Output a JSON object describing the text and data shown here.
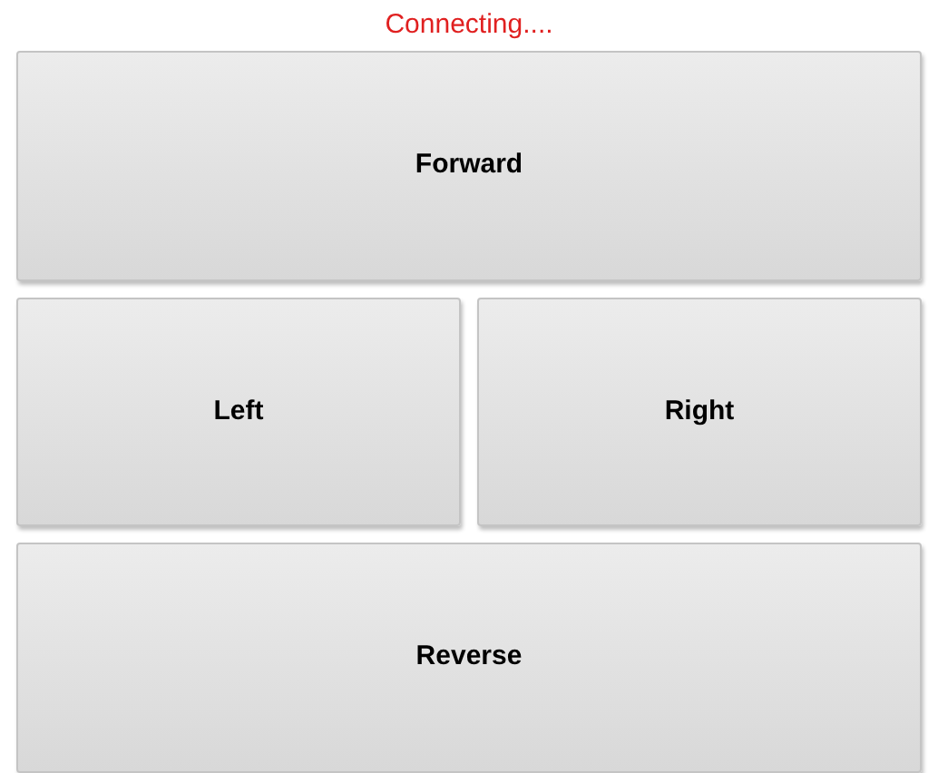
{
  "status": "Connecting....",
  "buttons": [
    {
      "label": "Forward",
      "kind": "wide"
    },
    {
      "label": "Left",
      "kind": "half"
    },
    {
      "label": "Right",
      "kind": "half"
    },
    {
      "label": "Reverse",
      "kind": "wide"
    }
  ]
}
